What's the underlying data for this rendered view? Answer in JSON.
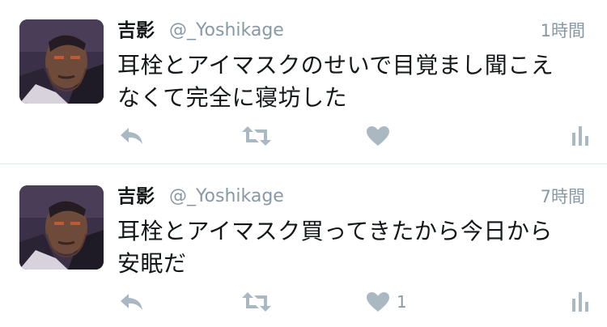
{
  "tweets": [
    {
      "user": {
        "name": "吉影",
        "handle": "@_Yoshikage"
      },
      "time": "1時間",
      "text_lines": [
        "耳栓とアイマスクのせいで目覚まし聞こえ",
        "なくて完全に寝坊した"
      ],
      "like_count": ""
    },
    {
      "user": {
        "name": "吉影",
        "handle": "@_Yoshikage"
      },
      "time": "7時間",
      "text_lines": [
        "耳栓とアイマスク買ってきたから今日から",
        "安眠だ"
      ],
      "like_count": "1"
    }
  ],
  "icons": {
    "reply": "reply-arrow",
    "retweet": "retweet-arrows",
    "like": "heart",
    "stats": "bar-chart"
  },
  "colors": {
    "icon_gray": "#aab8c2",
    "text": "#14171a",
    "secondary": "#8899a6",
    "divider": "#e1e8ed"
  }
}
